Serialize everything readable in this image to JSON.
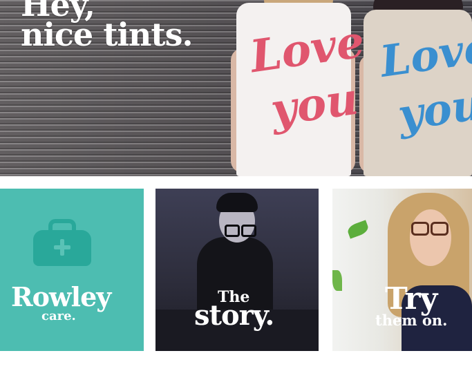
{
  "hero": {
    "headline_line1": "Hey,",
    "headline_line2": "nice tints.",
    "shirt_text_left_1": "Love",
    "shirt_text_left_2": "you",
    "shirt_text_right_1": "Love",
    "shirt_text_right_2": "you",
    "colors": {
      "left_shirt_print": "#e0566e",
      "right_shirt_print": "#3a8fd0"
    }
  },
  "tiles": [
    {
      "title": "Rowley",
      "subtitle": "care.",
      "icon": "first-aid-kit-icon",
      "background": "#4dbdb1"
    },
    {
      "title": "story.",
      "subtitle": "The"
    },
    {
      "title": "Try",
      "subtitle": "them on."
    }
  ]
}
